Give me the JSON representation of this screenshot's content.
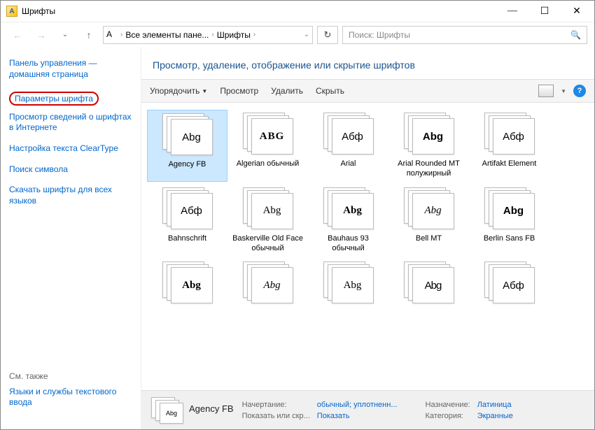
{
  "window": {
    "title": "Шрифты"
  },
  "breadcrumb": {
    "part1": "Все элементы пане...",
    "part2": "Шрифты"
  },
  "search": {
    "placeholder": "Поиск: Шрифты"
  },
  "sidebar": {
    "home": "Панель управления — домашняя страница",
    "links": [
      "Параметры шрифта",
      "Просмотр сведений о шрифтах в Интернете",
      "Настройка текста ClearType",
      "Поиск символа",
      "Скачать шрифты для всех языков"
    ],
    "seealso_label": "См. также",
    "seealso_link": "Языки и службы текстового ввода"
  },
  "heading": "Просмотр, удаление, отображение или скрытие шрифтов",
  "toolbar": {
    "organize": "Упорядочить",
    "preview": "Просмотр",
    "delete": "Удалить",
    "hide": "Скрыть"
  },
  "fonts": [
    {
      "sample": "Abg",
      "label": "Agency FB",
      "selected": true,
      "style": "font-family:'Agency FB',sans-serif;"
    },
    {
      "sample": "ABG",
      "label": "Algerian обычный",
      "style": "font-family:serif;font-weight:bold;letter-spacing:1px;"
    },
    {
      "sample": "Абф",
      "label": "Arial",
      "style": "font-family:Arial;"
    },
    {
      "sample": "Abg",
      "label": "Arial Rounded MT полужирный",
      "style": "font-family:Arial;font-weight:bold;"
    },
    {
      "sample": "Абф",
      "label": "Artifakt Element",
      "style": "font-family:Arial;"
    },
    {
      "sample": "Абф",
      "label": "Bahnschrift",
      "style": "font-family:Arial;"
    },
    {
      "sample": "Abg",
      "label": "Baskerville Old Face обычный",
      "style": "font-family:'Times New Roman',serif;"
    },
    {
      "sample": "Abg",
      "label": "Bauhaus 93 обычный",
      "style": "font-family:Impact;font-weight:900;"
    },
    {
      "sample": "Abg",
      "label": "Bell MT",
      "style": "font-family:'Times New Roman',serif;font-style:italic;"
    },
    {
      "sample": "Abg",
      "label": "Berlin Sans FB",
      "style": "font-family:Arial;font-weight:bold;"
    },
    {
      "sample": "Abg",
      "label": "",
      "style": "font-family:Impact;font-weight:900;"
    },
    {
      "sample": "Abg",
      "label": "",
      "style": "font-family:cursive;font-style:italic;"
    },
    {
      "sample": "Abg",
      "label": "",
      "style": "font-family:Georgia,serif;"
    },
    {
      "sample": "Abg",
      "label": "",
      "style": "font-family:Arial Narrow,sans-serif;letter-spacing:-1px;"
    },
    {
      "sample": "Абф",
      "label": "",
      "style": "font-family:Arial;"
    }
  ],
  "details": {
    "name": "Agency FB",
    "sample": "Abg",
    "row1_label": "Начертание:",
    "row1_value": "обычный; уплотненн...",
    "row2_label": "Показать или скр...",
    "row2_value": "Показать",
    "row3_label": "Назначение:",
    "row3_value": "Латиница",
    "row4_label": "Категория:",
    "row4_value": "Экранные"
  }
}
